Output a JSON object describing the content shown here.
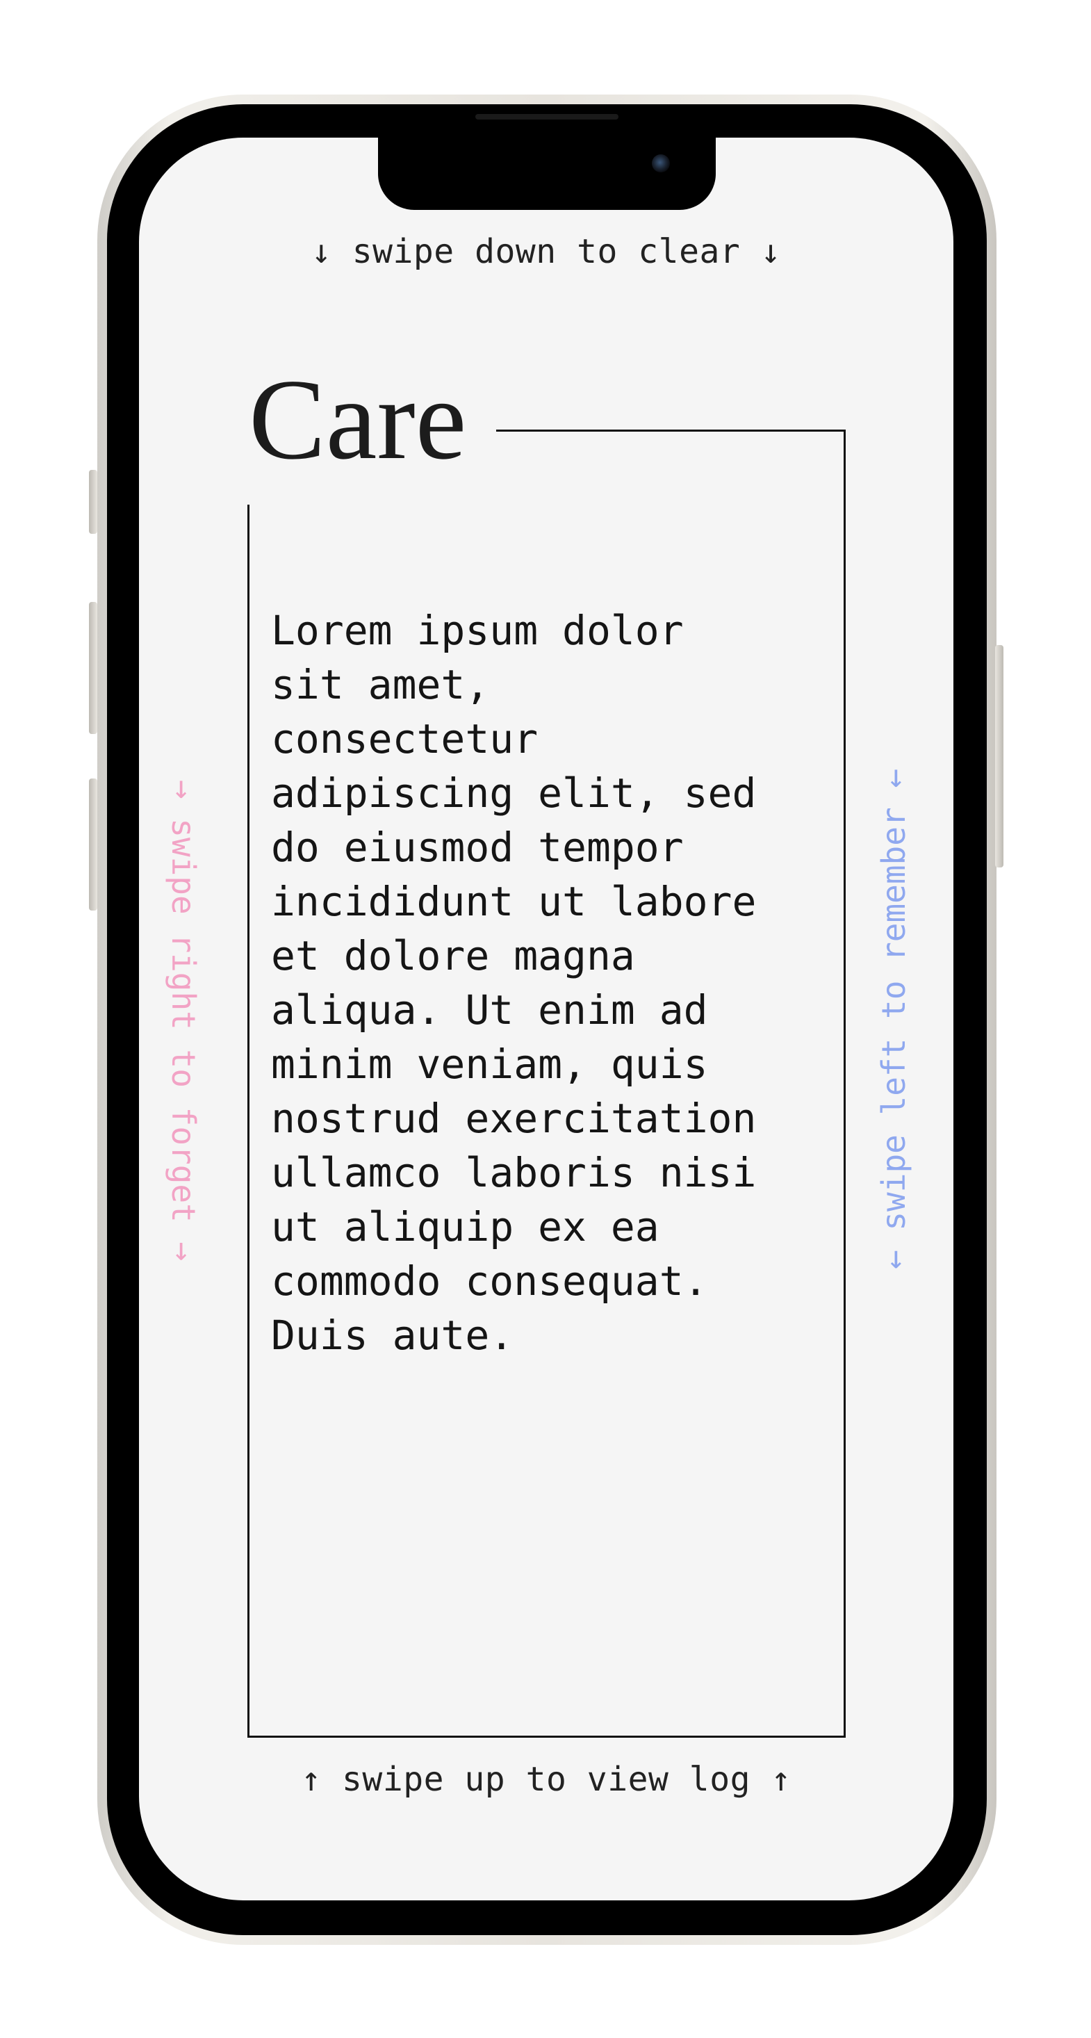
{
  "screen": {
    "background": "#f5f5f5",
    "hints": {
      "top": "↓ swipe down to clear ↓",
      "bottom": "↑ swipe up to view log ↑",
      "left": "→ swipe right to forget →",
      "right": "← swipe left to remember ←"
    },
    "hint_colors": {
      "left": "#f2a3c5",
      "right": "#8fa8ef"
    },
    "card": {
      "title": "Care",
      "body": "Lorem ipsum dolor\nsit amet,\nconsectetur\nadipiscing elit, sed\ndo eiusmod tempor\nincididunt ut labore\net dolore magna\naliqua. Ut enim ad\nminim veniam, quis\nnostrud exercitation\nullamco laboris nisi\nut aliquip ex ea\ncommodo consequat.\nDuis aute."
    }
  }
}
